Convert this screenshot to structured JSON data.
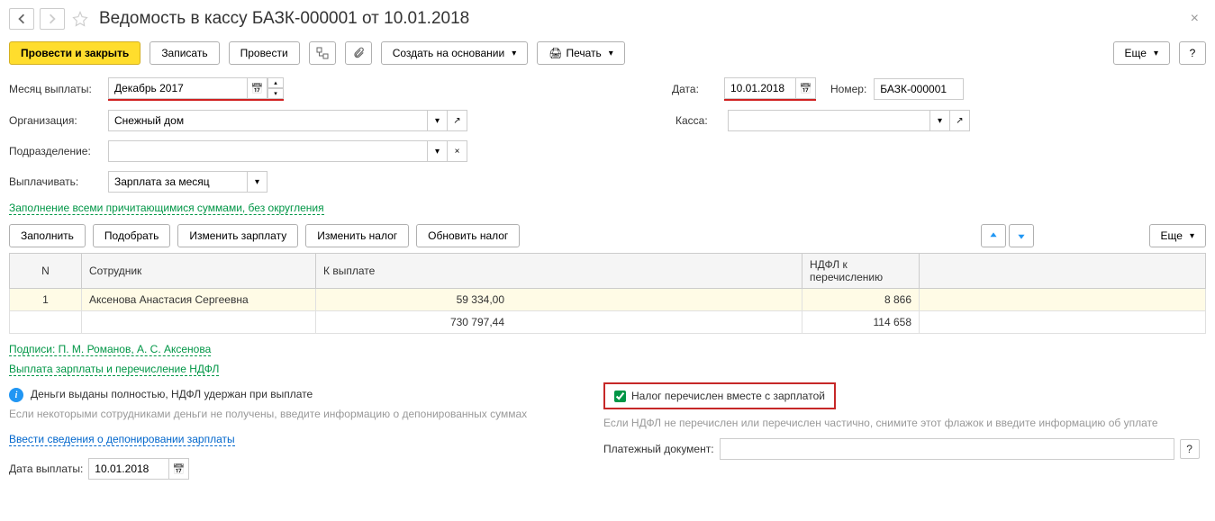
{
  "header": {
    "title": "Ведомость в кассу БАЗК-000001 от 10.01.2018"
  },
  "toolbar": {
    "post_close": "Провести и закрыть",
    "save": "Записать",
    "post": "Провести",
    "create_based": "Создать на основании",
    "print": "Печать",
    "more": "Еще"
  },
  "form": {
    "month_label": "Месяц выплаты:",
    "month_value": "Декабрь 2017",
    "date_label": "Дата:",
    "date_value": "10.01.2018",
    "number_label": "Номер:",
    "number_value": "БАЗК-000001",
    "org_label": "Организация:",
    "org_value": "Снежный дом",
    "cash_label": "Касса:",
    "cash_value": "",
    "dept_label": "Подразделение:",
    "dept_value": "",
    "pay_label": "Выплачивать:",
    "pay_value": "Зарплата за месяц",
    "fill_link": "Заполнение всеми причитающимися суммами, без округления"
  },
  "table_toolbar": {
    "fill": "Заполнить",
    "select": "Подобрать",
    "change_salary": "Изменить зарплату",
    "change_tax": "Изменить налог",
    "update_tax": "Обновить налог",
    "more": "Еще"
  },
  "table": {
    "headers": {
      "n": "N",
      "employee": "Сотрудник",
      "to_pay": "К выплате",
      "ndfl": "НДФЛ к перечислению"
    },
    "rows": [
      {
        "n": "1",
        "employee": "Аксенова Анастасия Сергеевна",
        "to_pay": "59 334,00",
        "ndfl": "8 866"
      }
    ],
    "totals": {
      "to_pay": "730 797,44",
      "ndfl": "114 658"
    }
  },
  "bottom": {
    "signatures_link": "Подписи: П. М. Романов, А. С. Аксенова",
    "payment_ndfl_link": "Выплата зарплаты и перечисление НДФЛ",
    "info_text": "Деньги выданы полностью, НДФЛ удержан при выплате",
    "tax_checkbox_label": "Налог перечислен вместе с зарплатой",
    "hint_left": "Если некоторыми сотрудниками деньги не получены, введите информацию о депонированных суммах",
    "hint_right": "Если НДФЛ не перечислен или перечислен частично, снимите этот флажок и введите информацию об уплате",
    "deposit_link": "Ввести сведения о депонировании зарплаты",
    "payment_doc_label": "Платежный документ:",
    "pay_date_label": "Дата выплаты:",
    "pay_date_value": "10.01.2018"
  }
}
